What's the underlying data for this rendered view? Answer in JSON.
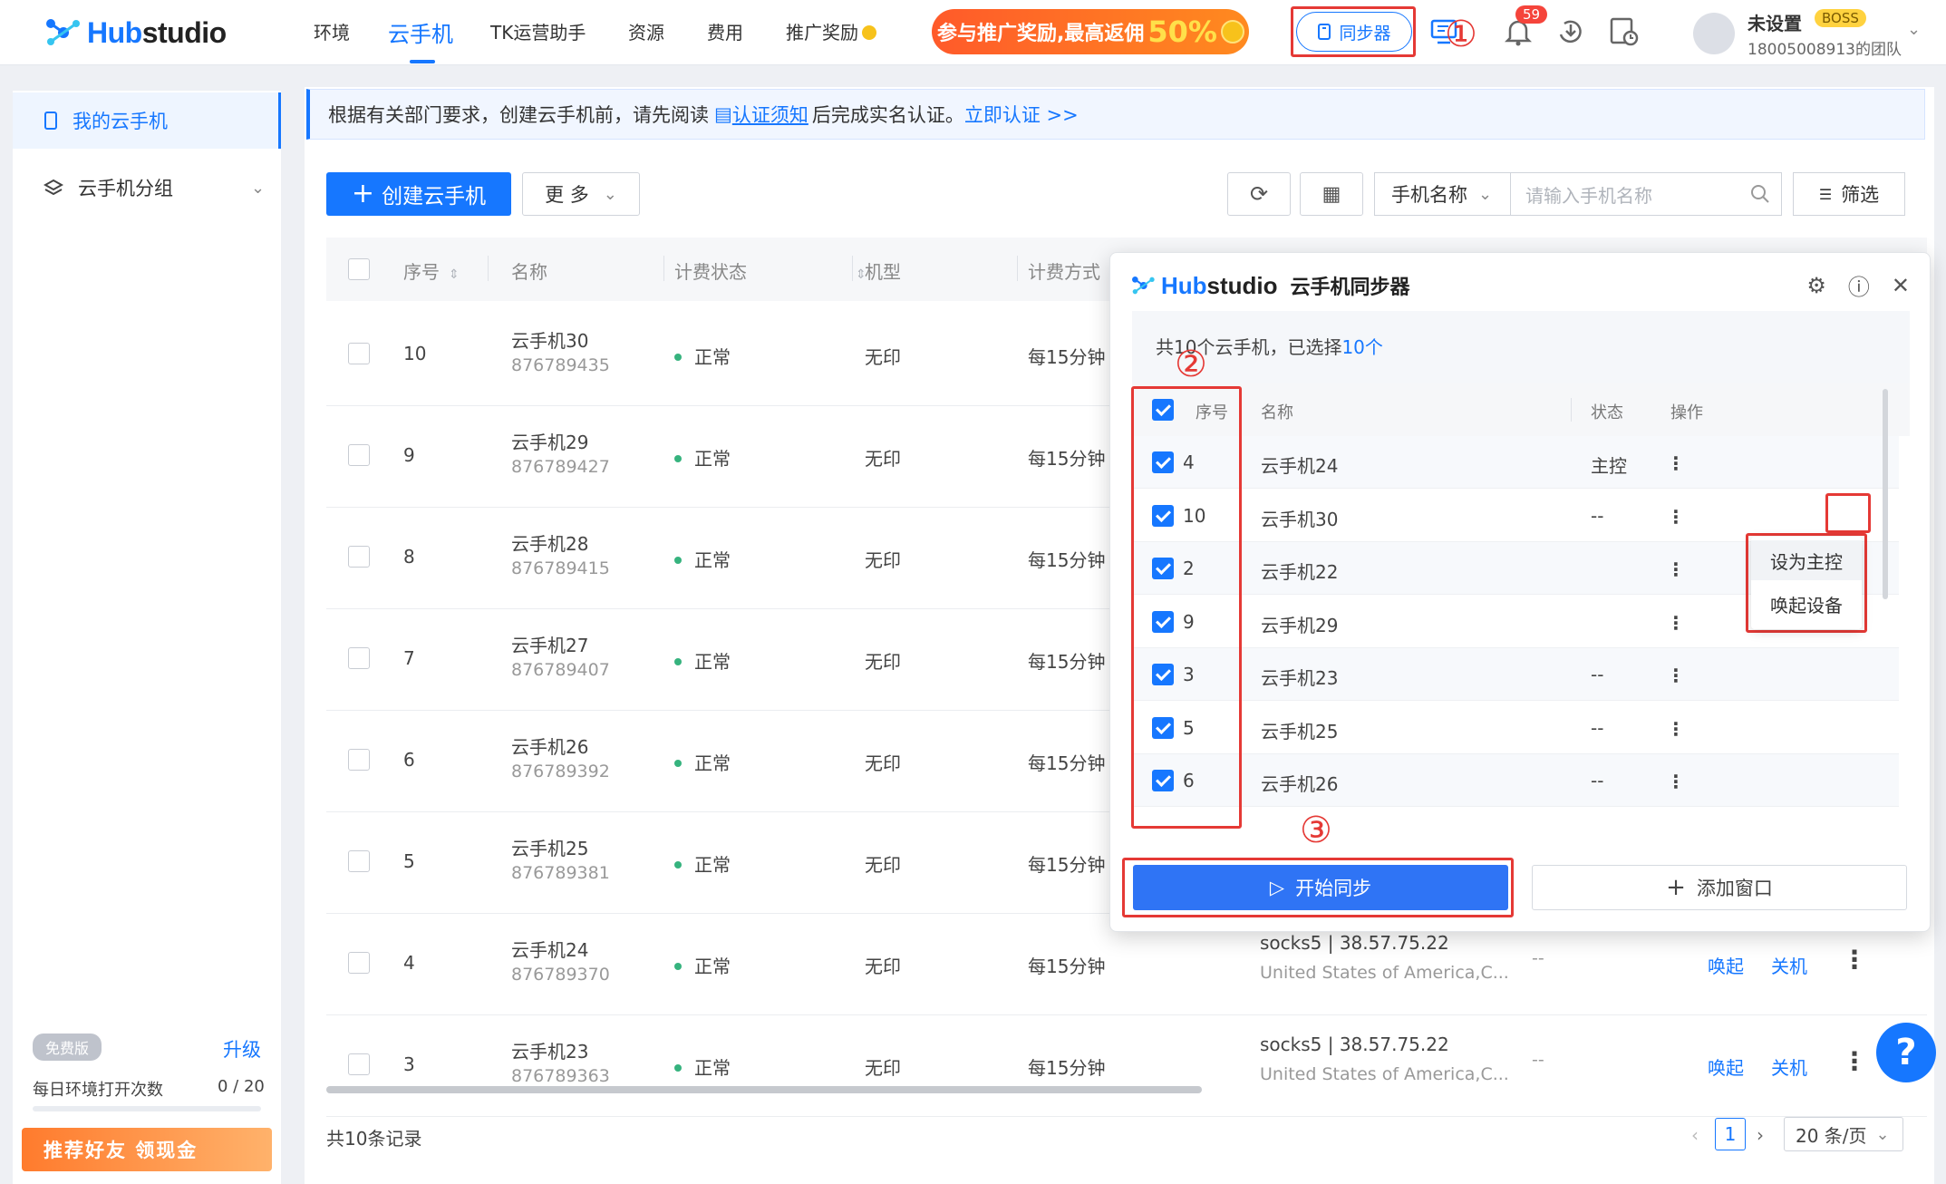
{
  "app": {
    "logo_prefix": "Hub",
    "logo_suffix": "studio"
  },
  "nav": {
    "items": [
      "环境",
      "云手机",
      "TK运营助手",
      "资源",
      "费用",
      "推广奖励"
    ],
    "active": "云手机"
  },
  "promo": {
    "text": "参与推广奖励,最高返佣",
    "highlight": "50%"
  },
  "header": {
    "sync_button": "同步器",
    "notification_count": "59",
    "user_name": "未设置",
    "user_badge": "BOSS",
    "team": "18005008913的团队"
  },
  "annotations": {
    "one": "①",
    "two": "②",
    "three": "③"
  },
  "sidebar": {
    "items": [
      {
        "label": "我的云手机",
        "active": true
      },
      {
        "label": "云手机分组",
        "active": false
      }
    ],
    "plan_tag": "免费版",
    "upgrade": "升级",
    "daily_label": "每日环境打开次数",
    "daily_value": "0 / 20",
    "refer": "推荐好友 领现金"
  },
  "notice": {
    "prefix": "根据有关部门要求，创建云手机前，请先阅读",
    "doc_link": "认证须知",
    "middle": "后完成实名认证。",
    "action_link": "立即认证 >>"
  },
  "toolbar": {
    "create_label": "创建云手机",
    "more_label": "更 多",
    "search_field": "手机名称",
    "search_placeholder": "请输入手机名称",
    "filter_label": "筛选"
  },
  "table": {
    "headers": [
      "序号",
      "名称",
      "计费状态",
      "机型",
      "计费方式"
    ],
    "rows": [
      {
        "no": "10",
        "name": "云手机30",
        "id": "876789435",
        "status": "正常",
        "model": "无印",
        "billing": "每15分钟"
      },
      {
        "no": "9",
        "name": "云手机29",
        "id": "876789427",
        "status": "正常",
        "model": "无印",
        "billing": "每15分钟"
      },
      {
        "no": "8",
        "name": "云手机28",
        "id": "876789415",
        "status": "正常",
        "model": "无印",
        "billing": "每15分钟"
      },
      {
        "no": "7",
        "name": "云手机27",
        "id": "876789407",
        "status": "正常",
        "model": "无印",
        "billing": "每15分钟"
      },
      {
        "no": "6",
        "name": "云手机26",
        "id": "876789392",
        "status": "正常",
        "model": "无印",
        "billing": "每15分钟"
      },
      {
        "no": "5",
        "name": "云手机25",
        "id": "876789381",
        "status": "正常",
        "model": "无印",
        "billing": "每15分钟"
      },
      {
        "no": "4",
        "name": "云手机24",
        "id": "876789370",
        "status": "正常",
        "model": "无印",
        "billing": "每15分钟",
        "proxy": "socks5 | 38.57.75.22",
        "location": "United States of America,C...",
        "dash": "--",
        "wake": "唤起",
        "shutdown": "关机"
      },
      {
        "no": "3",
        "name": "云手机23",
        "id": "876789363",
        "status": "正常",
        "model": "无印",
        "billing": "每15分钟",
        "proxy": "socks5 | 38.57.75.22",
        "location": "United States of America,C...",
        "dash": "--",
        "wake": "唤起",
        "shutdown": "关机"
      }
    ],
    "total": "共10条记录",
    "page": "1",
    "page_size": "20 条/页"
  },
  "sync_dialog": {
    "brand_prefix": "Hub",
    "brand_suffix": "studio",
    "title": "云手机同步器",
    "summary_prefix": "共10个云手机，已选择",
    "summary_count": "10个",
    "headers": {
      "no": "序号",
      "name": "名称",
      "status": "状态",
      "action": "操作"
    },
    "rows": [
      {
        "no": "4",
        "name": "云手机24",
        "status": "主控"
      },
      {
        "no": "10",
        "name": "云手机30",
        "status": "--"
      },
      {
        "no": "2",
        "name": "云手机22",
        "status": ""
      },
      {
        "no": "9",
        "name": "云手机29",
        "status": ""
      },
      {
        "no": "3",
        "name": "云手机23",
        "status": "--"
      },
      {
        "no": "5",
        "name": "云手机25",
        "status": "--"
      },
      {
        "no": "6",
        "name": "云手机26",
        "status": "--"
      }
    ],
    "menu": [
      "设为主控",
      "唤起设备"
    ],
    "start_label": "开始同步",
    "add_label": "添加窗口"
  }
}
